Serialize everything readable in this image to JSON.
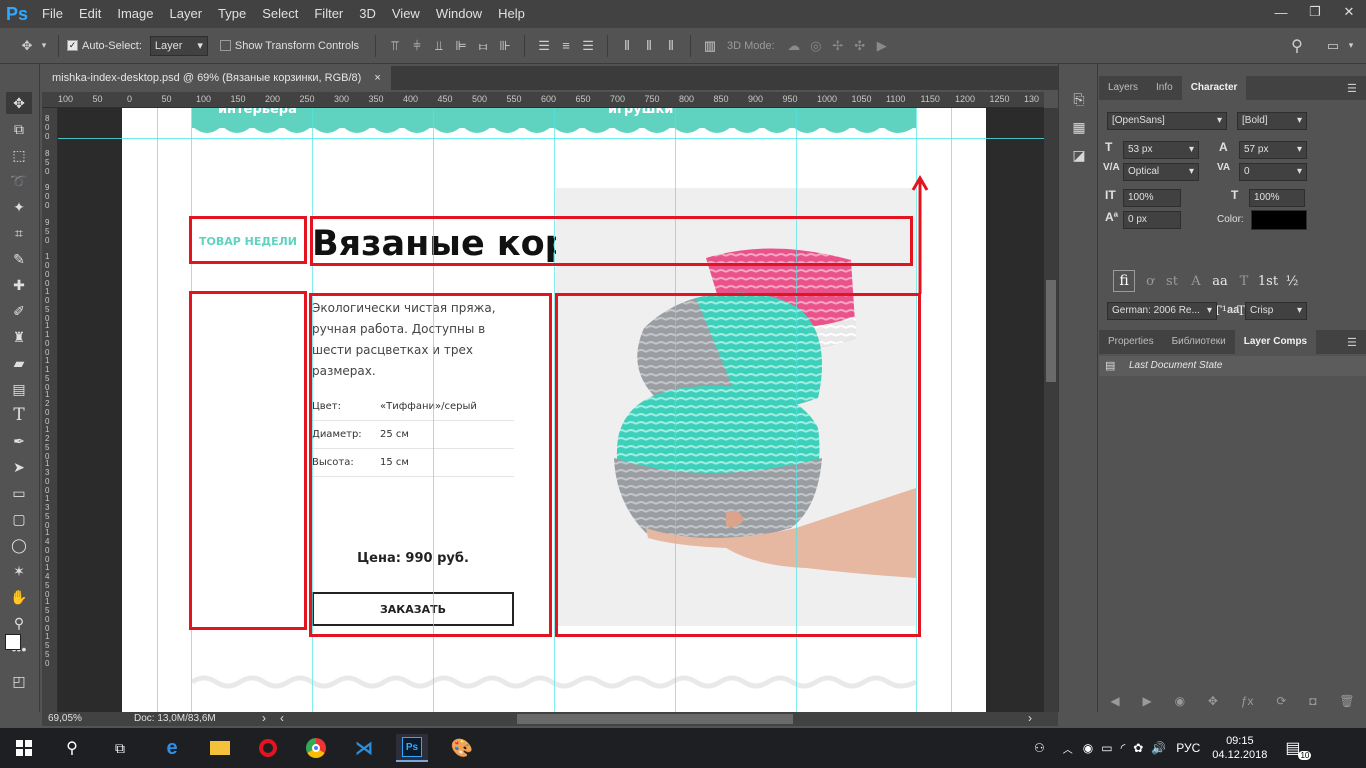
{
  "app": {
    "logo": "Ps",
    "menus": [
      "File",
      "Edit",
      "Image",
      "Layer",
      "Type",
      "Select",
      "Filter",
      "3D",
      "View",
      "Window",
      "Help"
    ]
  },
  "options": {
    "auto_select_label": "Auto-Select:",
    "auto_select_value": "Layer",
    "transform_label": "Show Transform Controls",
    "mode_3d": "3D Mode:"
  },
  "document": {
    "tab_title": "mishka-index-desktop.psd @ 69% (Вязаные корзинки, RGB/8)",
    "close": "×"
  },
  "ruler": {
    "top": [
      "100",
      "50",
      "0",
      "50",
      "100",
      "150",
      "200",
      "250",
      "300",
      "350",
      "400",
      "450",
      "500",
      "550",
      "600",
      "650",
      "700",
      "750",
      "800",
      "850",
      "900",
      "950",
      "1000",
      "1050",
      "1100",
      "1150",
      "1200",
      "1250",
      "130"
    ],
    "left": [
      "800",
      "850",
      "900",
      "950",
      "1000",
      "1050",
      "1100",
      "1150",
      "1200",
      "1250",
      "1300",
      "1350",
      "1400",
      "1450",
      "1500",
      "1550"
    ]
  },
  "canvas": {
    "top_menu_left": "интерьера",
    "top_menu_right": "игрушки",
    "badge": "ТОВАР НЕДЕЛИ",
    "product_title": "Вязаные корзинки",
    "description": "Экологически чистая пряжа, ручная работа. Доступны в шести расцветках и трех размерах.",
    "specs": [
      {
        "label": "Цвет:",
        "value": "«Тиффани»/серый"
      },
      {
        "label": "Диаметр:",
        "value": "25 см"
      },
      {
        "label": "Высота:",
        "value": "15 см"
      }
    ],
    "price": "Цена: 990 руб.",
    "order_button": "ЗАКАЗАТЬ"
  },
  "panels": {
    "top_tabs": [
      "Layers",
      "Info",
      "Character"
    ],
    "font_family": "[OpenSans]",
    "font_style": "[Bold]",
    "font_size": "53 px",
    "leading": "57 px",
    "kerning": "Optical",
    "tracking": "0",
    "vscale": "100%",
    "hscale": "100%",
    "baseline": "0 px",
    "color_label": "Color:",
    "language": "German: 2006 Re...",
    "aa_label": "a",
    "antialias": "Crisp",
    "bottom_tabs": [
      "Properties",
      "Библиотеки",
      "Layer Comps"
    ],
    "layer_comp": "Last Document State"
  },
  "status": {
    "zoom": "69,05%",
    "doc": "Doc: 13,0M/83,6M"
  },
  "taskbar": {
    "lang": "РУС",
    "time": "09:15",
    "date": "04.12.2018",
    "notif": "10"
  },
  "colors": {
    "accent": "#31a8ff",
    "guide": "#4ee6e6",
    "mint": "#5fd3c0",
    "red": "#e3141f"
  }
}
